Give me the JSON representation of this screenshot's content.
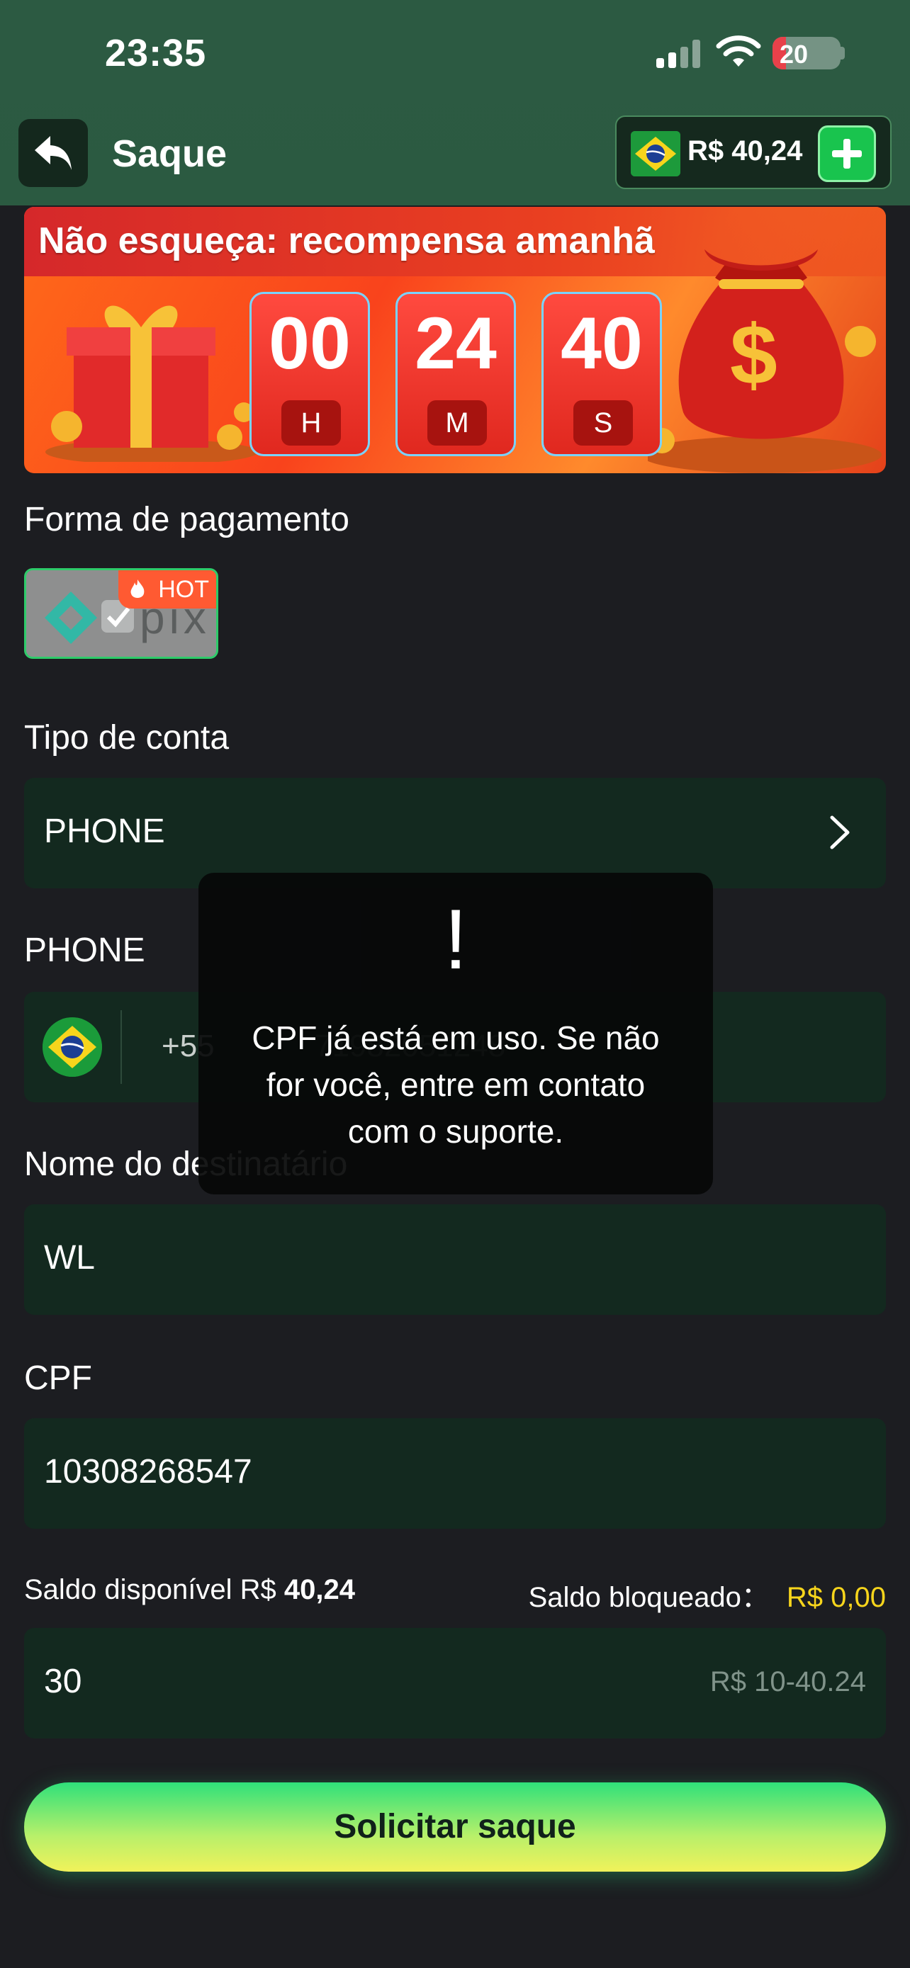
{
  "status_bar": {
    "time": "23:35",
    "battery": "20"
  },
  "header": {
    "title": "Saque",
    "balance": "R$ 40,24"
  },
  "banner": {
    "title": "Não esqueça: recompensa amanhã",
    "timer": [
      {
        "value": "00",
        "unit": "H"
      },
      {
        "value": "24",
        "unit": "M"
      },
      {
        "value": "40",
        "unit": "S"
      }
    ]
  },
  "payment": {
    "label": "Forma de pagamento",
    "method_badge": "HOT",
    "method_name": "pix"
  },
  "account_type": {
    "label": "Tipo de conta",
    "value": "PHONE"
  },
  "phone": {
    "label": "PHONE",
    "country_code": "+55",
    "number": "71982051248"
  },
  "recipient": {
    "label": "Nome do destinatário",
    "value": "WL"
  },
  "cpf": {
    "label": "CPF",
    "value": "10308268547"
  },
  "saldo": {
    "available_label": "Saldo disponível R$",
    "available_value": "40,24",
    "blocked_label": "Saldo bloqueado：",
    "blocked_value": "R$ 0,00"
  },
  "amount": {
    "value": "30",
    "hint": "R$ 10-40.24"
  },
  "submit_label": "Solicitar saque",
  "toast": {
    "icon": "!",
    "message": "CPF já está em uso. Se não for você, entre em contato com o suporte."
  },
  "colors": {
    "accent_green": "#19c44e",
    "header_bg": "#2b5a41",
    "field_bg": "#13291f",
    "blocked_yellow": "#f7d51c"
  }
}
